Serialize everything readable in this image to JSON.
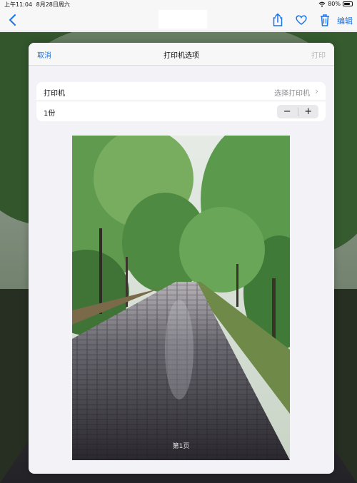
{
  "status_bar": {
    "time": "上午11:04",
    "date": "8月28日周六",
    "battery": "80%",
    "battery_level": 0.8
  },
  "nav_bar": {
    "back_icon": "chevron-left-icon",
    "icons": [
      "share-icon",
      "heart-icon",
      "trash-icon"
    ],
    "edit_label": "编辑",
    "accent_color": "#1a73e8"
  },
  "dialog": {
    "cancel_label": "取消",
    "title": "打印机选项",
    "print_label": "打印",
    "printer_row": {
      "label": "打印机",
      "value": "选择打印机"
    },
    "copies_row": {
      "label": "1份",
      "minus": "−",
      "plus": "+"
    },
    "preview": {
      "page_label": "第1页"
    }
  }
}
